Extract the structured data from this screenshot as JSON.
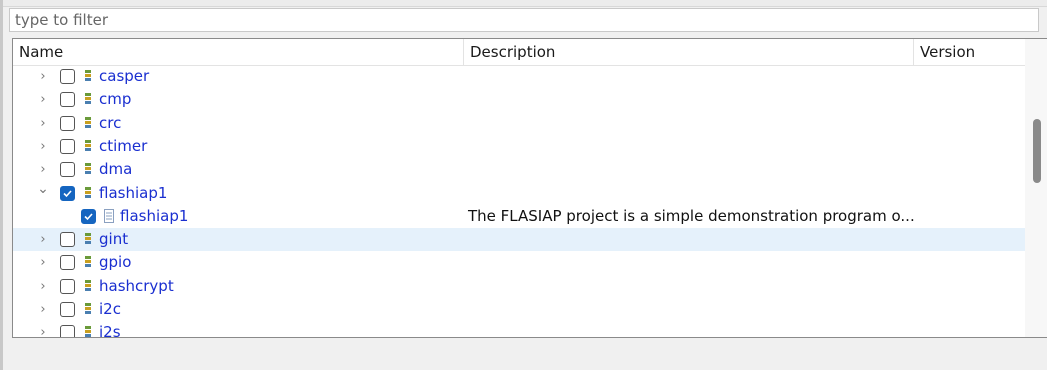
{
  "filter": {
    "placeholder": "type to filter",
    "value": ""
  },
  "columns": {
    "name": "Name",
    "description": "Description",
    "version": "Version"
  },
  "rows": [
    {
      "label": "casper",
      "expanded": false,
      "checked": false,
      "level": 0,
      "description": ""
    },
    {
      "label": "cmp",
      "expanded": false,
      "checked": false,
      "level": 0,
      "description": ""
    },
    {
      "label": "crc",
      "expanded": false,
      "checked": false,
      "level": 0,
      "description": ""
    },
    {
      "label": "ctimer",
      "expanded": false,
      "checked": false,
      "level": 0,
      "description": ""
    },
    {
      "label": "dma",
      "expanded": false,
      "checked": false,
      "level": 0,
      "description": ""
    },
    {
      "label": "flashiap1",
      "expanded": true,
      "checked": true,
      "level": 0,
      "description": ""
    },
    {
      "label": "flashiap1",
      "expanded": false,
      "checked": true,
      "level": 1,
      "description": "The FLASIAP project is a simple demonstration program o..."
    },
    {
      "label": "gint",
      "expanded": false,
      "checked": false,
      "level": 0,
      "description": "",
      "highlighted": true
    },
    {
      "label": "gpio",
      "expanded": false,
      "checked": false,
      "level": 0,
      "description": ""
    },
    {
      "label": "hashcrypt",
      "expanded": false,
      "checked": false,
      "level": 0,
      "description": ""
    },
    {
      "label": "i2c",
      "expanded": false,
      "checked": false,
      "level": 0,
      "description": ""
    },
    {
      "label": "i2s",
      "expanded": false,
      "checked": false,
      "level": 0,
      "description": ""
    }
  ],
  "colors": {
    "link": "#1a2fd0",
    "checkbox_checked": "#1565c0",
    "row_highlight": "#e5f1fb"
  }
}
